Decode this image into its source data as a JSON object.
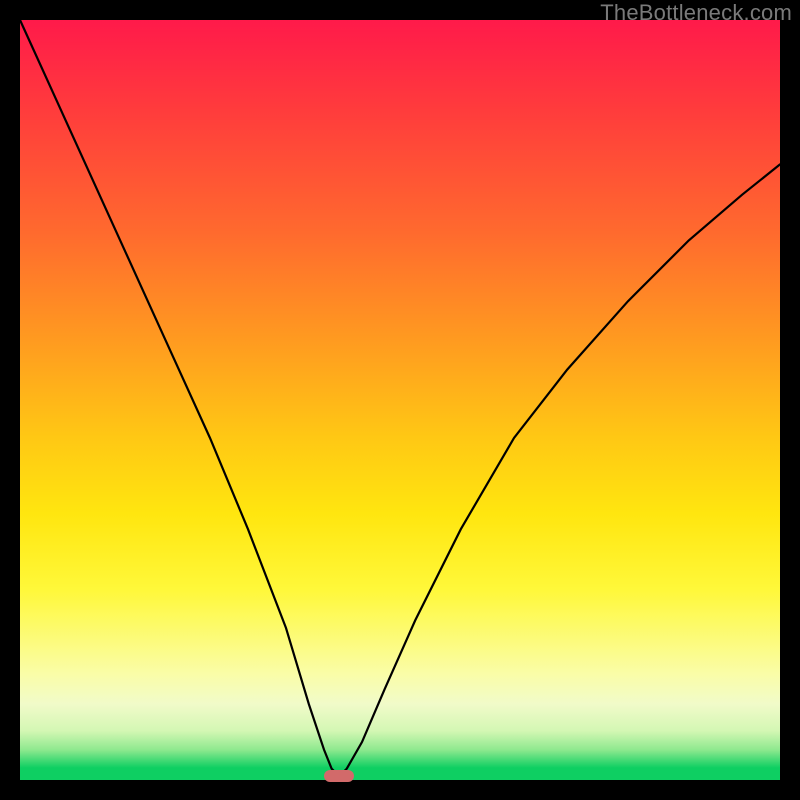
{
  "watermark": {
    "text": "TheBottleneck.com"
  },
  "chart_data": {
    "type": "line",
    "title": "",
    "xlabel": "",
    "ylabel": "",
    "xlim": [
      0,
      100
    ],
    "ylim": [
      0,
      100
    ],
    "grid": false,
    "legend": false,
    "background_gradient": {
      "direction": "vertical",
      "stops": [
        {
          "pos": 0,
          "color": "#ff1a4a"
        },
        {
          "pos": 28,
          "color": "#ff6a2e"
        },
        {
          "pos": 55,
          "color": "#ffc814"
        },
        {
          "pos": 75,
          "color": "#fff83a"
        },
        {
          "pos": 90,
          "color": "#f1fbc9"
        },
        {
          "pos": 96,
          "color": "#8fe98f"
        },
        {
          "pos": 100,
          "color": "#0ecf62"
        }
      ]
    },
    "series": [
      {
        "name": "bottleneck-curve",
        "color": "#000000",
        "x": [
          0,
          5,
          10,
          15,
          20,
          25,
          30,
          35,
          38,
          40,
          41,
          42,
          43,
          45,
          48,
          52,
          58,
          65,
          72,
          80,
          88,
          95,
          100
        ],
        "y": [
          100,
          89,
          78,
          67,
          56,
          45,
          33,
          20,
          10,
          4,
          1.5,
          0.5,
          1.5,
          5,
          12,
          21,
          33,
          45,
          54,
          63,
          71,
          77,
          81
        ]
      }
    ],
    "marker": {
      "name": "optimal-point",
      "x": 42,
      "y": 0.5,
      "color": "#d26a6a"
    }
  }
}
